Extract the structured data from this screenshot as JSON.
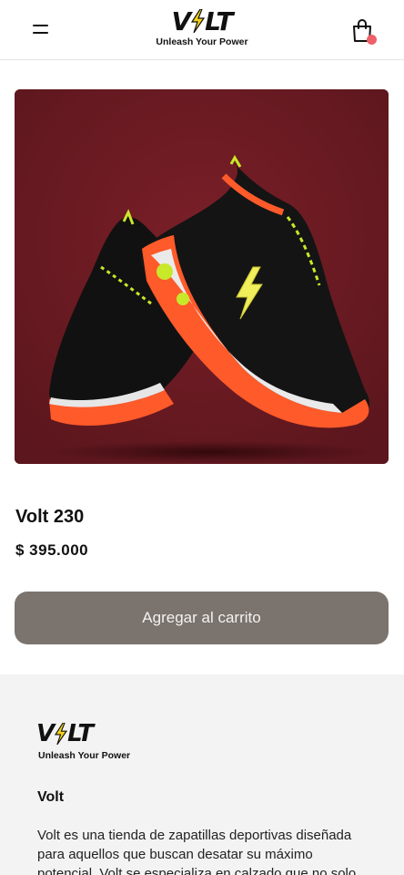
{
  "header": {
    "menu_icon": "hamburger-menu-icon",
    "brand": {
      "word_left": "V",
      "word_right": "LT",
      "bolt_icon": "lightning-bolt-icon",
      "tagline": "Unleash Your Power"
    },
    "cart_icon": "shopping-bag-icon",
    "cart_badge_color": "#f0606a"
  },
  "product": {
    "image_icon": "sneaker-image",
    "image_bg": "#6b1a22",
    "name": "Volt 230",
    "price": "$ 395.000",
    "add_to_cart_label": "Agregar al carrito",
    "button_color": "#7a736e"
  },
  "footer": {
    "brand": {
      "word_left": "V",
      "word_right": "LT",
      "tagline": "Unleash Your Power"
    },
    "title": "Volt",
    "description": "Volt es una tienda de zapatillas deportivas diseñada para aquellos que buscan desatar su máximo potencial. Volt se especializa en calzado que no solo"
  },
  "colors": {
    "accent_bolt": "#f5d21a",
    "shoe_orange": "#ff5a2a",
    "shoe_lime": "#c8e82a"
  }
}
